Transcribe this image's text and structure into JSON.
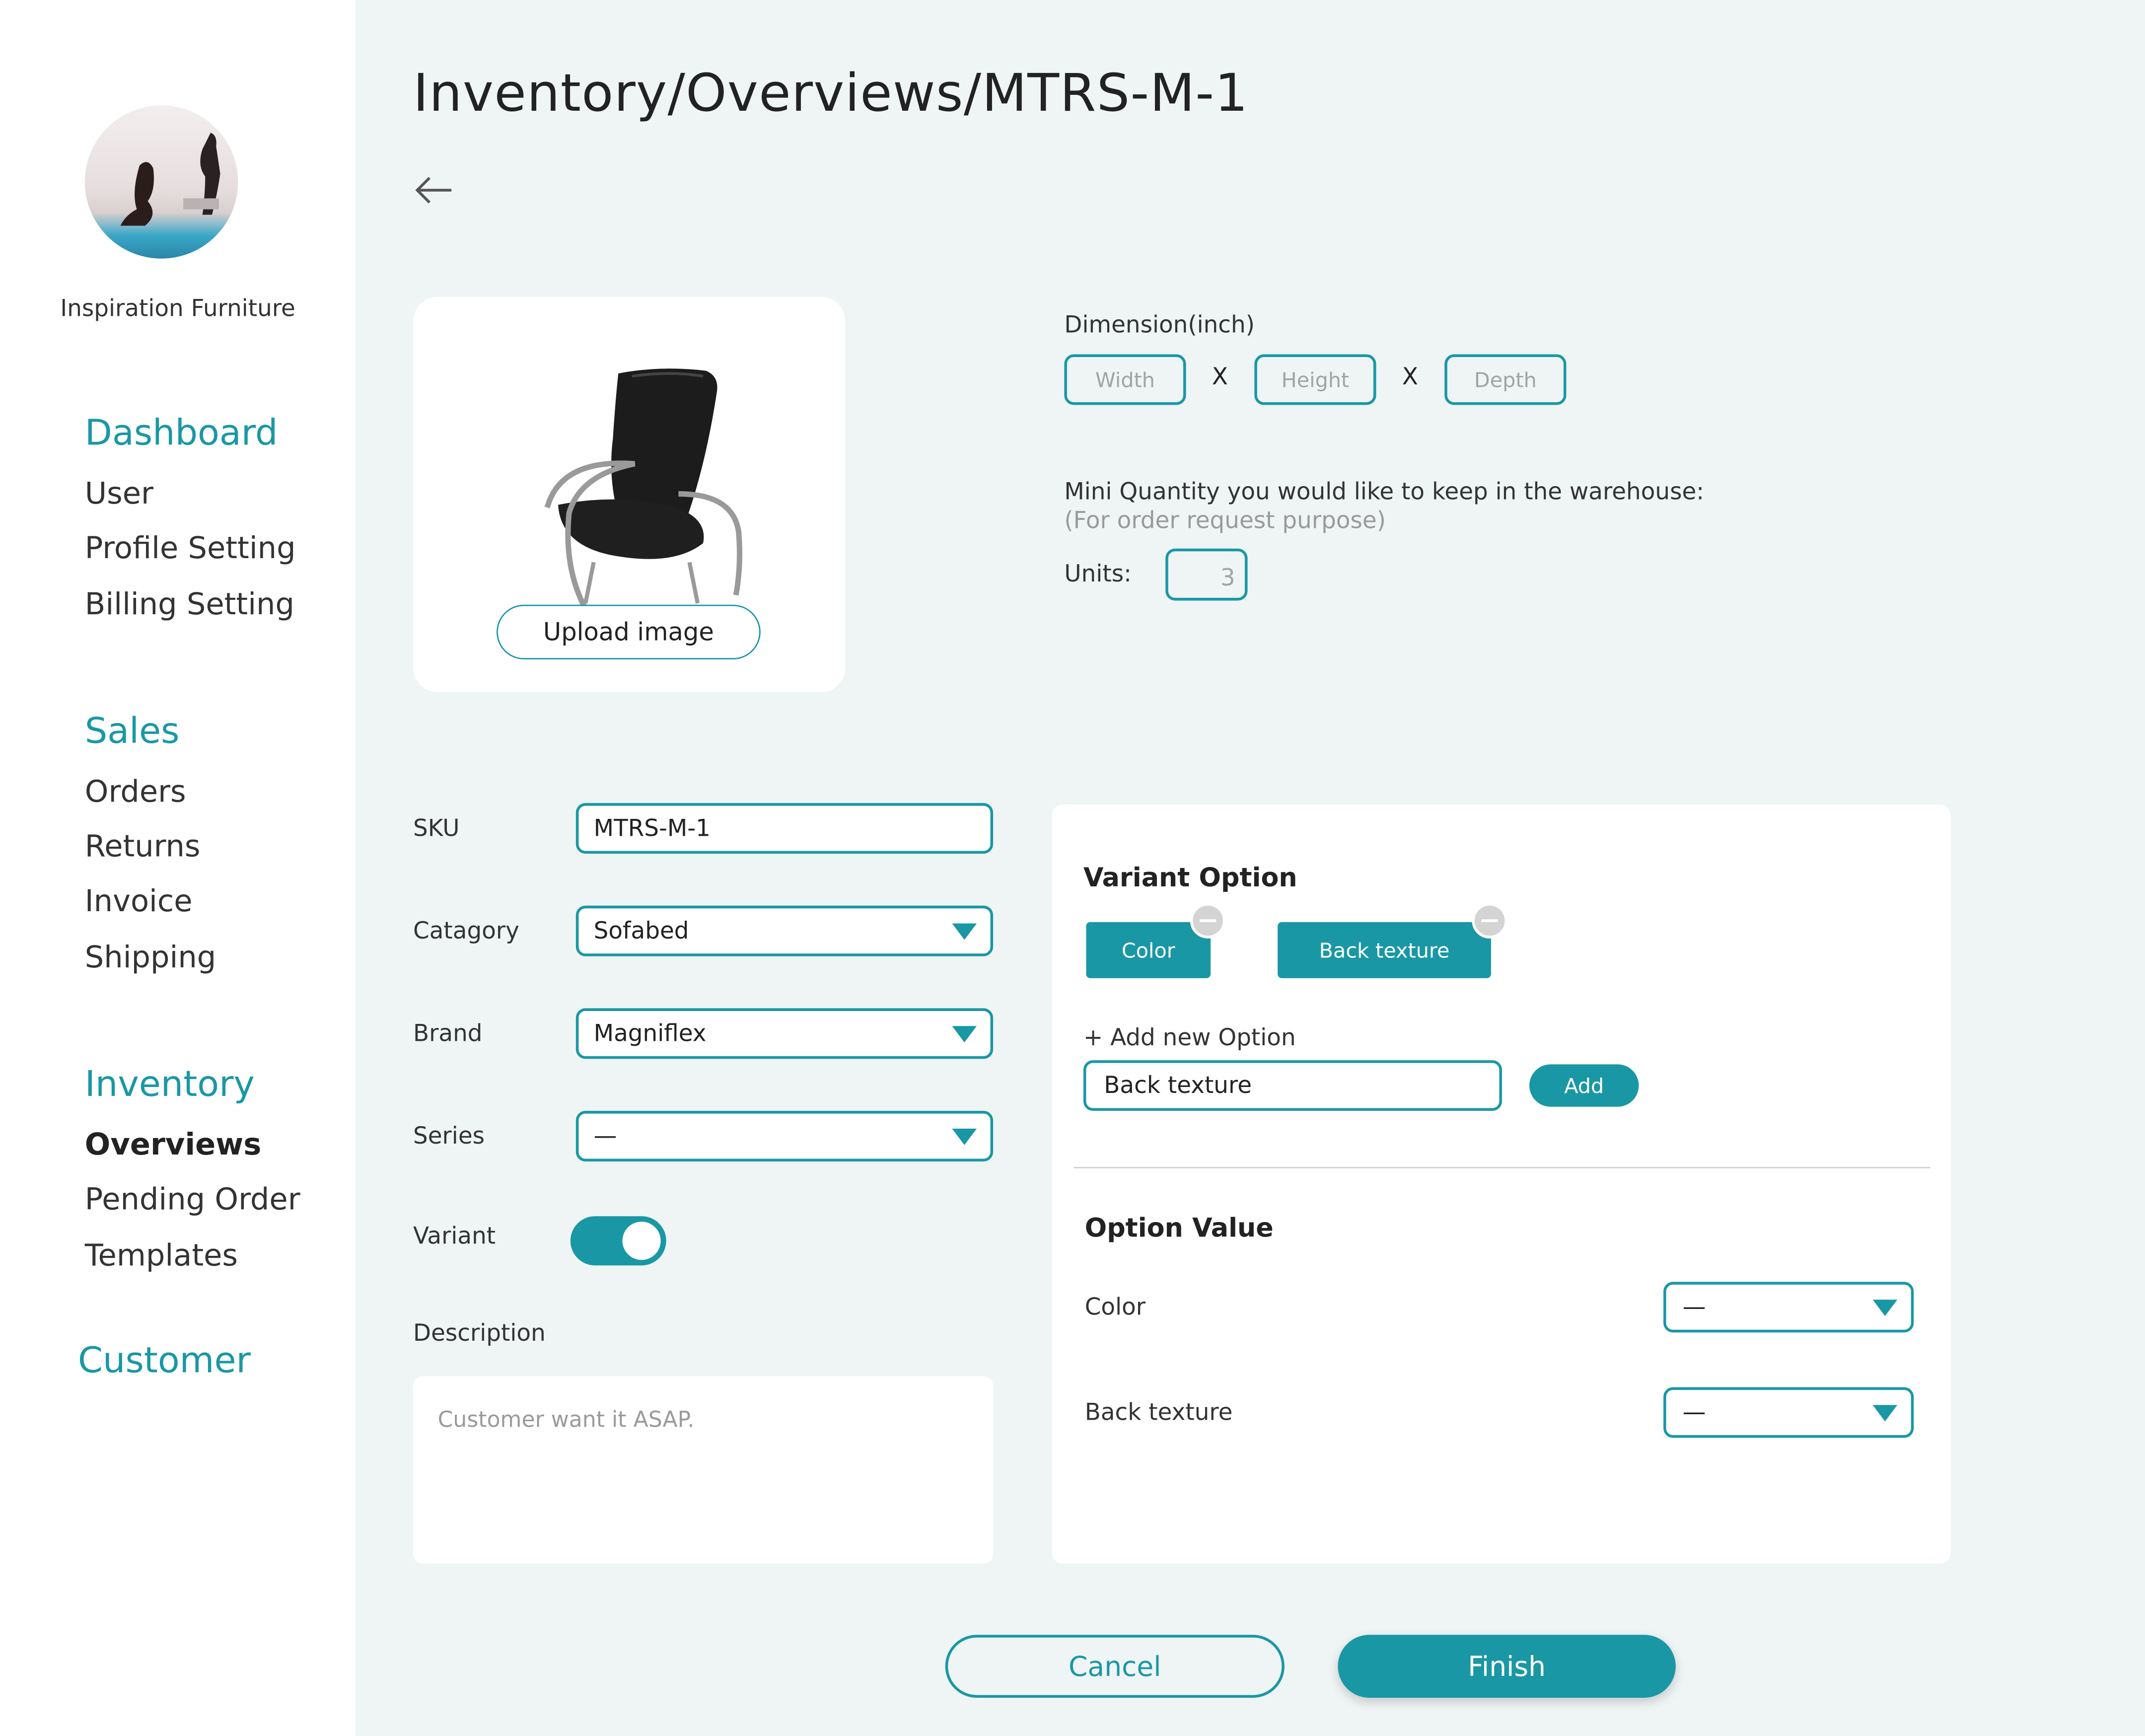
{
  "sidebar": {
    "company_name": "Inspiration Furniture",
    "sections": [
      {
        "title": "Dashboard",
        "items": [
          "User",
          "Profile Setting",
          "Billing Setting"
        ]
      },
      {
        "title": "Sales",
        "items": [
          "Orders",
          "Returns",
          "Invoice",
          "Shipping"
        ]
      },
      {
        "title": "Inventory",
        "items": [
          "Overviews",
          "Pending Order",
          "Templates"
        ],
        "active_item": "Overviews"
      },
      {
        "title": "Customer",
        "items": []
      }
    ]
  },
  "header": {
    "breadcrumb": "Inventory/Overviews/MTRS-M-1"
  },
  "image_card": {
    "upload_label": "Upload image"
  },
  "dimension": {
    "label": "Dimension(inch)",
    "width_placeholder": "Width",
    "height_placeholder": "Height",
    "depth_placeholder": "Depth",
    "separator": "X"
  },
  "quantity": {
    "label": "Mini Quantity you would like to keep in the warehouse:",
    "note": "(For order request purpose)",
    "units_label": "Units:",
    "units_value": "3"
  },
  "form": {
    "sku_label": "SKU",
    "sku_value": "MTRS-M-1",
    "category_label": "Catagory",
    "category_value": "Sofabed",
    "brand_label": "Brand",
    "brand_value": "Magniflex",
    "series_label": "Series",
    "series_value": "—",
    "variant_label": "Variant",
    "variant_enabled": true,
    "description_label": "Description",
    "description_value": "Customer want it ASAP."
  },
  "variant_panel": {
    "title": "Variant Option",
    "chips": [
      "Color",
      "Back texture"
    ],
    "add_option_label": "+ Add new Option",
    "new_option_value": "Back texture",
    "add_button": "Add",
    "option_value_title": "Option Value",
    "option_rows": [
      {
        "label": "Color",
        "value": "—"
      },
      {
        "label": "Back texture",
        "value": "—"
      }
    ]
  },
  "footer": {
    "cancel_label": "Cancel",
    "finish_label": "Finish"
  },
  "colors": {
    "accent": "#1a97a5",
    "background": "#eff4f5",
    "sidebar": "#ffffff"
  }
}
